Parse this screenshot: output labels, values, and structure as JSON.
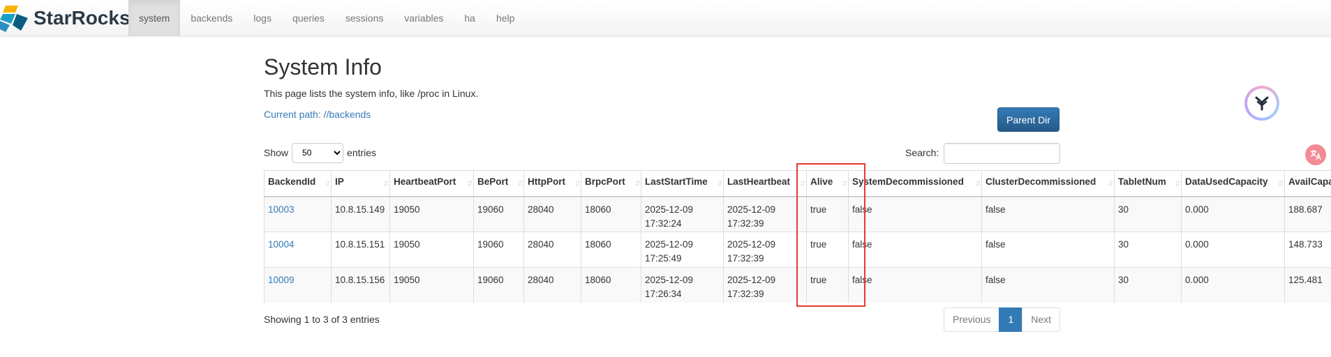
{
  "brand": {
    "name": "StarRocks"
  },
  "nav": {
    "items": [
      {
        "label": "system",
        "active": true
      },
      {
        "label": "backends"
      },
      {
        "label": "logs"
      },
      {
        "label": "queries"
      },
      {
        "label": "sessions"
      },
      {
        "label": "variables"
      },
      {
        "label": "ha"
      },
      {
        "label": "help"
      }
    ]
  },
  "page": {
    "title": "System Info",
    "description": "This page lists the system info, like /proc in Linux.",
    "current_path": "Current path: //backends",
    "parent_button": "Parent Dir"
  },
  "controls": {
    "show_label": "Show",
    "entries_value": "50",
    "entries_label": "entries",
    "search_label": "Search:",
    "search_value": ""
  },
  "table": {
    "columns": [
      "BackendId",
      "IP",
      "HeartbeatPort",
      "BePort",
      "HttpPort",
      "BrpcPort",
      "LastStartTime",
      "LastHeartbeat",
      "Alive",
      "SystemDecommissioned",
      "ClusterDecommissioned",
      "TabletNum",
      "DataUsedCapacity",
      "AvailCapacity"
    ],
    "rows": [
      [
        "10003",
        "10.8.15.149",
        "19050",
        "19060",
        "28040",
        "18060",
        "2025-12-09 17:32:24",
        "2025-12-09 17:32:39",
        "true",
        "false",
        "false",
        "30",
        "0.000",
        "188.687"
      ],
      [
        "10004",
        "10.8.15.151",
        "19050",
        "19060",
        "28040",
        "18060",
        "2025-12-09 17:25:49",
        "2025-12-09 17:32:39",
        "true",
        "false",
        "false",
        "30",
        "0.000",
        "148.733"
      ],
      [
        "10009",
        "10.8.15.156",
        "19050",
        "19060",
        "28040",
        "18060",
        "2025-12-09 17:26:34",
        "2025-12-09 17:32:39",
        "true",
        "false",
        "false",
        "30",
        "0.000",
        "125.481"
      ]
    ]
  },
  "footer": {
    "info": "Showing 1 to 3 of 3 entries",
    "previous": "Previous",
    "current_page": "1",
    "next": "Next"
  },
  "colors": {
    "link": "#337ab7",
    "primary_button": "#286090",
    "highlight_box": "#e53935"
  }
}
